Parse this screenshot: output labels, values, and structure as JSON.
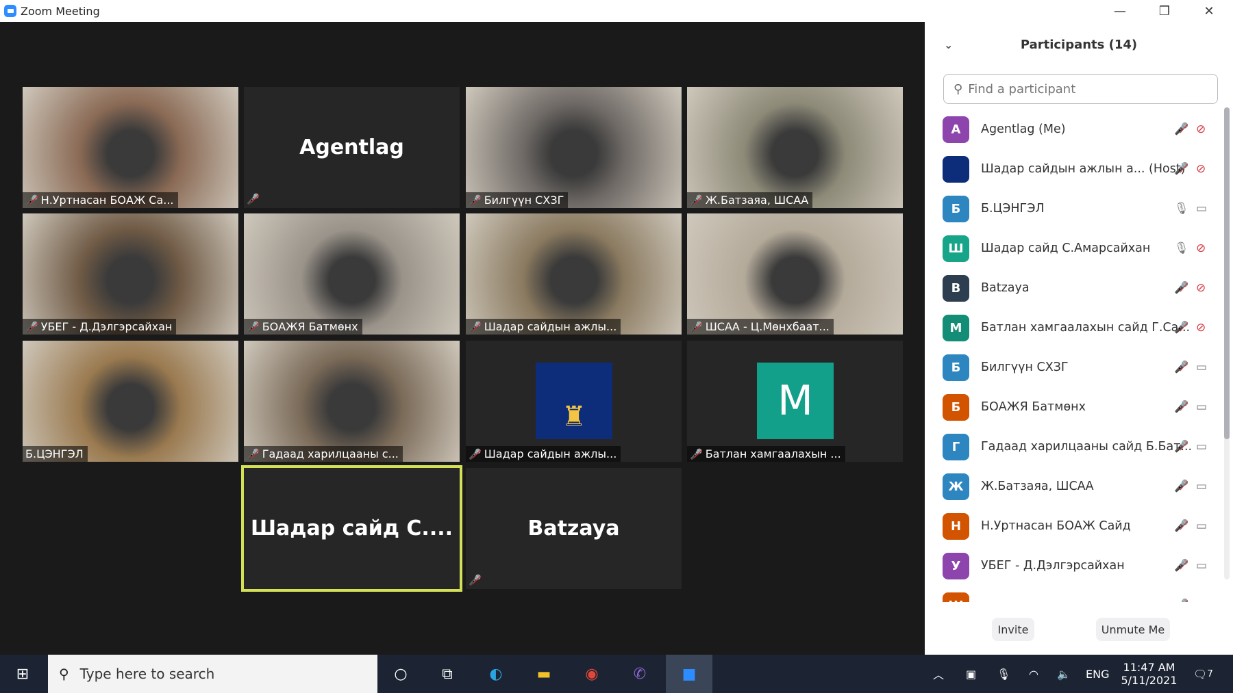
{
  "window": {
    "title": "Zoom Meeting",
    "minimize": "—",
    "restore": "❐",
    "close": "✕"
  },
  "tiles": [
    {
      "name": "Н.Уртнасан БОАЖ Са...",
      "muted": true,
      "video": "#8a6a55"
    },
    {
      "name": "",
      "muted": true,
      "display": "Agentlag"
    },
    {
      "name": "Билгүүн СХЗГ",
      "muted": true,
      "video": "#6f6a66"
    },
    {
      "name": "Ж.Батзаяа, ШСАА",
      "muted": true,
      "video": "#8d8a78"
    },
    {
      "name": "УБЕГ - Д.Дэлгэрсайхан",
      "muted": true,
      "video": "#6f5a45"
    },
    {
      "name": "БОАЖЯ Батмөнх",
      "muted": true,
      "video": "#9a938a"
    },
    {
      "name": "Шадар сайдын ажлы...",
      "muted": true,
      "video": "#8a7a60"
    },
    {
      "name": "ШСАА - Ц.Мөнхбаат...",
      "muted": true,
      "video": "#b4aa9a"
    },
    {
      "name": "Б.ЦЭНГЭЛ",
      "muted": false,
      "video": "#9a7a50"
    },
    {
      "name": "Гадаад харилцааны с...",
      "muted": true,
      "video": "#7a6a58"
    },
    {
      "name": "Шадар сайдын ажлы...",
      "muted": true,
      "logo": "МОНГОЛ УЛСЫН ЗАСГИЙН ГАЗАР"
    },
    {
      "name": "Батлан хамгаалахын ...",
      "muted": true,
      "letter": "M"
    },
    {
      "name": "",
      "muted": false,
      "display": "Шадар сайд С....",
      "active": true
    },
    {
      "name": "",
      "muted": true,
      "display": "Batzaya"
    }
  ],
  "panel": {
    "title": "Participants (14)",
    "search_placeholder": "Find a participant",
    "participants": [
      {
        "initial": "A",
        "name": "Agentlag (Me)",
        "color": "#8e44ad",
        "mic": "muted",
        "cam": "off"
      },
      {
        "initial": "",
        "name": "Шадар сайдын ажлын а...  (Host)",
        "color": "#0d2c7a",
        "mic": "muted",
        "cam": "off"
      },
      {
        "initial": "Б",
        "name": "Б.ЦЭНГЭЛ",
        "color": "#2e86c1",
        "mic": "on",
        "cam": "on"
      },
      {
        "initial": "Ш",
        "name": "Шадар сайд С.Амарсайхан",
        "color": "#17a589",
        "mic": "active",
        "cam": "off"
      },
      {
        "initial": "B",
        "name": "Batzaya",
        "color": "#2c3e50",
        "mic": "muted",
        "cam": "off"
      },
      {
        "initial": "M",
        "name": "Батлан хамгаалахын сайд Г.Са...",
        "color": "#138d75",
        "mic": "muted",
        "cam": "off"
      },
      {
        "initial": "Б",
        "name": "Билгүүн СХЗГ",
        "color": "#2e86c1",
        "mic": "muted",
        "cam": "on"
      },
      {
        "initial": "Б",
        "name": "БОАЖЯ Батмөнх",
        "color": "#d35400",
        "mic": "muted",
        "cam": "on"
      },
      {
        "initial": "Г",
        "name": "Гадаад харилцааны сайд Б.Бат...",
        "color": "#2e86c1",
        "mic": "muted",
        "cam": "on"
      },
      {
        "initial": "Ж",
        "name": "Ж.Батзаяа, ШСАА",
        "color": "#2e86c1",
        "mic": "muted",
        "cam": "on"
      },
      {
        "initial": "Н",
        "name": "Н.Уртнасан БОАЖ Сайд",
        "color": "#d35400",
        "mic": "muted",
        "cam": "on"
      },
      {
        "initial": "У",
        "name": "УБЕГ - Д.Дэлгэрсайхан",
        "color": "#8e44ad",
        "mic": "muted",
        "cam": "on"
      },
      {
        "initial": "Ш",
        "name": "",
        "color": "#d35400",
        "mic": "muted",
        "cam": "on"
      }
    ],
    "invite": "Invite",
    "unmute": "Unmute Me"
  },
  "taskbar": {
    "search_placeholder": "Type here to search",
    "lang": "ENG",
    "time": "11:47 AM",
    "date": "5/11/2021",
    "notifications": "7"
  }
}
